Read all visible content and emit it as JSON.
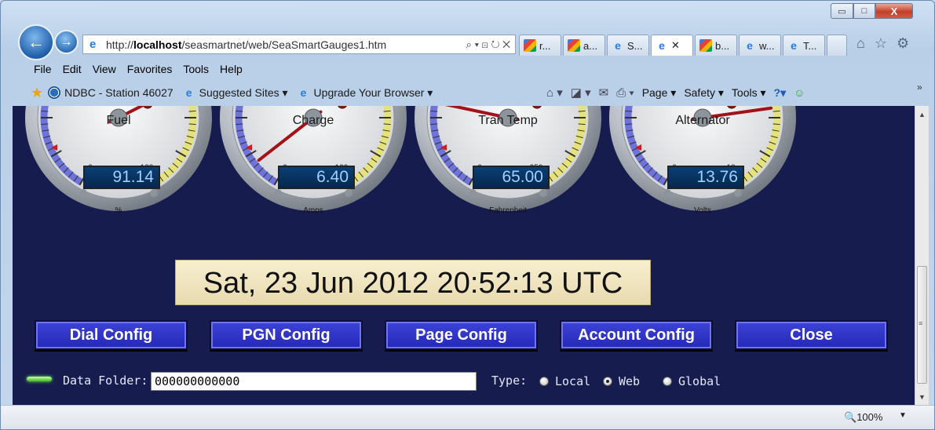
{
  "window": {
    "caption_buttons": {
      "minimize": "▭",
      "maximize": "□",
      "close": "X"
    }
  },
  "address_bar": {
    "prefix": "http://",
    "host": "localhost",
    "path": "/seasmartnet/web/SeaSmartGauges1.htm",
    "controls": "⌕ ▾ ⊡ ↻ ✕"
  },
  "tabs": [
    {
      "icon": "google",
      "label": "r..."
    },
    {
      "icon": "google",
      "label": "a..."
    },
    {
      "icon": "ie",
      "label": "S..."
    },
    {
      "icon": "ie",
      "label": "",
      "active": true,
      "close": "✕"
    },
    {
      "icon": "google",
      "label": "b..."
    },
    {
      "icon": "ie",
      "label": "w..."
    },
    {
      "icon": "ie",
      "label": "T..."
    }
  ],
  "toolbar_icons": [
    "home-icon",
    "star-icon",
    "gear-icon"
  ],
  "menu": [
    "File",
    "Edit",
    "View",
    "Favorites",
    "Tools",
    "Help"
  ],
  "favorites": {
    "items": [
      {
        "label": "NDBC - Station 46027"
      },
      {
        "label": "Suggested Sites ▾"
      },
      {
        "label": "Upgrade Your Browser ▾"
      }
    ]
  },
  "command_bar": {
    "page": "Page ▾",
    "safety": "Safety ▾",
    "tools": "Tools ▾",
    "help": "?▾",
    "overflow": "»"
  },
  "gauges": [
    {
      "title": "Fuel",
      "value": "91.14",
      "unit": "%",
      "min_label": "0",
      "max_label": "100",
      "needle_deg": 63
    },
    {
      "title": "Charge",
      "value": "6.40",
      "unit": "Amps",
      "min_label": "0",
      "max_label": "100",
      "needle_deg": -128
    },
    {
      "title": "Tran Temp",
      "value": "65.00",
      "unit": "Fahrenheit",
      "min_label": "0",
      "max_label": "250",
      "needle_deg": -78
    },
    {
      "title": "Alternator",
      "value": "13.76",
      "unit": "Volts",
      "min_label": "0",
      "max_label": "18",
      "needle_deg": 82
    }
  ],
  "datetime": "Sat, 23 Jun 2012 20:52:13 UTC",
  "buttons": [
    "Dial Config",
    "PGN Config",
    "Page Config",
    "Account Config",
    "Close"
  ],
  "data_folder": {
    "label": "Data Folder:",
    "value": "000000000000"
  },
  "type": {
    "label": "Type:",
    "options": [
      "Local",
      "Web",
      "Global"
    ],
    "selected": "Web"
  },
  "status_bar": {
    "zoom": "100%"
  },
  "colors": {
    "page_bg": "#161d4e",
    "button": "#2b30c4",
    "lcd_text": "#9fd0ff",
    "date_panel": "#f2e7c3"
  }
}
